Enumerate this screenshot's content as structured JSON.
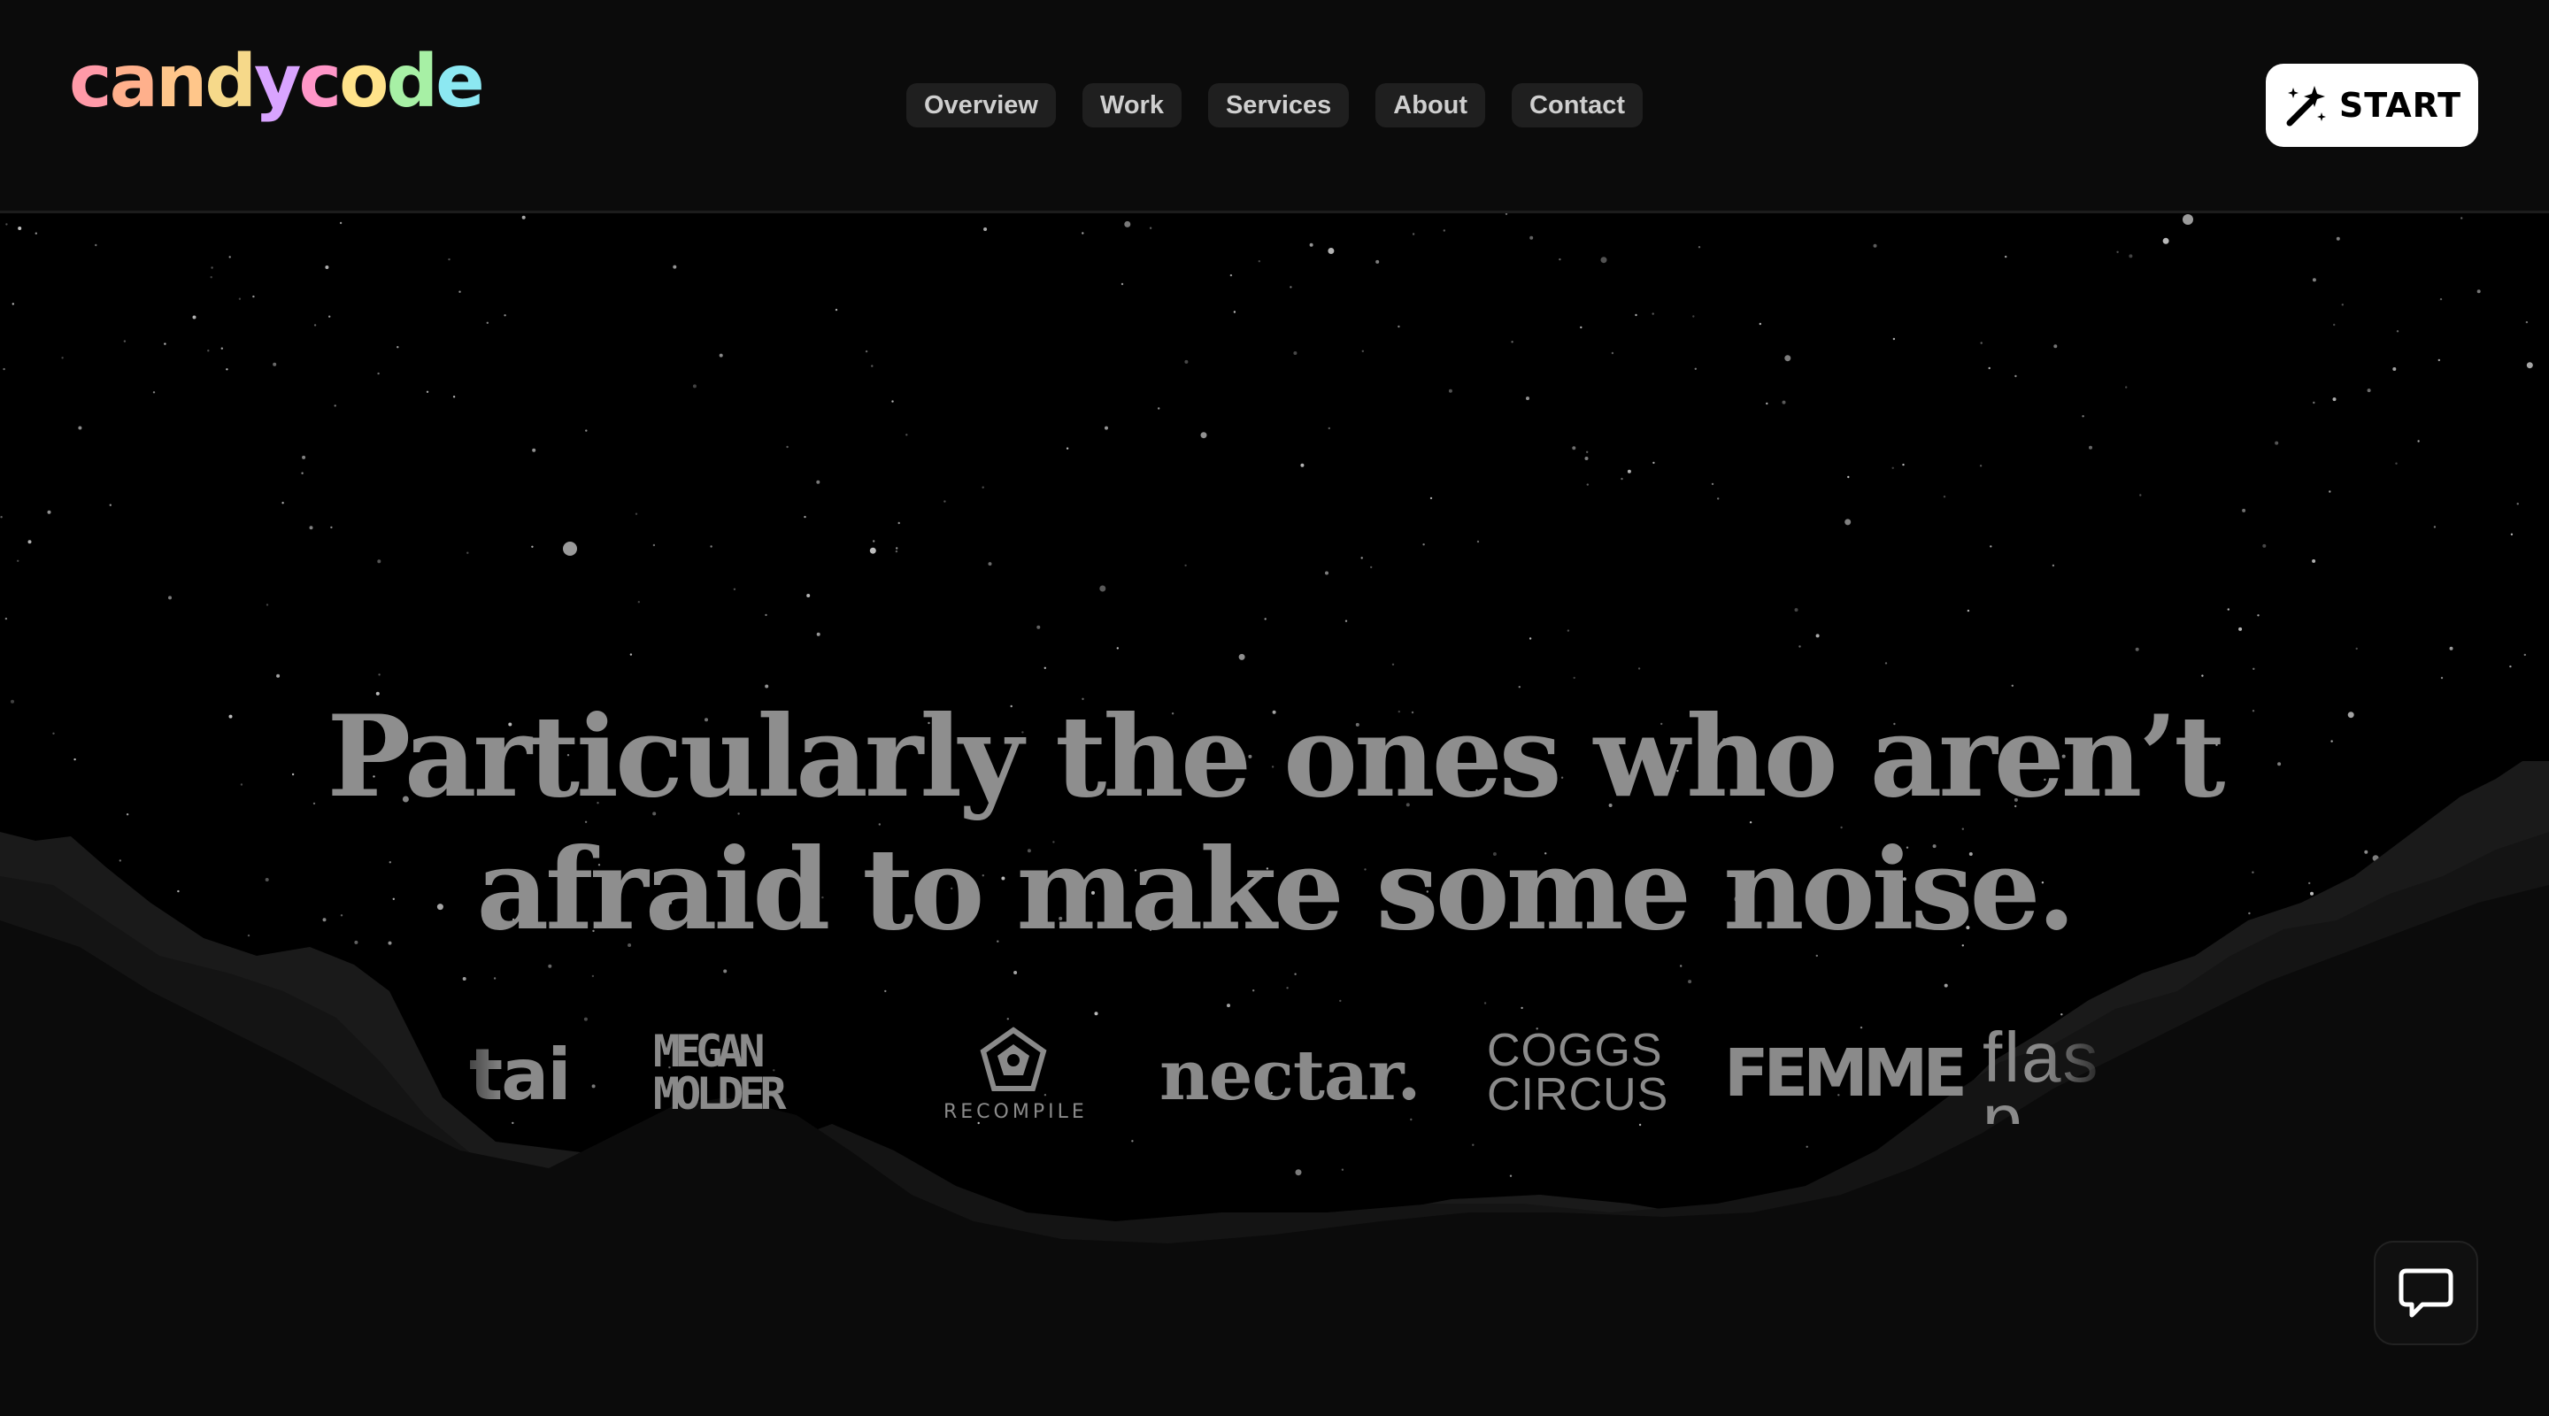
{
  "header": {
    "logo": {
      "letters": [
        {
          "char": "c",
          "color": "#ff9aa8"
        },
        {
          "char": "a",
          "color": "#ffb08c"
        },
        {
          "char": "n",
          "color": "#ffc68a"
        },
        {
          "char": "d",
          "color": "#f6d98a"
        },
        {
          "char": "y",
          "color": "#d9a4ff"
        },
        {
          "char": "c",
          "color": "#ff96c8"
        },
        {
          "char": "o",
          "color": "#ffe38a"
        },
        {
          "char": "d",
          "color": "#a7f0a5"
        },
        {
          "char": "e",
          "color": "#8ce8f2"
        }
      ]
    },
    "nav": [
      {
        "label": "Overview"
      },
      {
        "label": "Work"
      },
      {
        "label": "Services"
      },
      {
        "label": "About"
      },
      {
        "label": "Contact"
      }
    ],
    "start_label": "START"
  },
  "hero": {
    "headline_line1": "Particularly the ones who aren’t",
    "headline_line2": "afraid to make some noise."
  },
  "brands": {
    "tai": "tai",
    "megan_line1": "MEGAN",
    "megan_line2": "MOLDER",
    "recompile": "RECOMPILE",
    "nectar": "nectar.",
    "coggs_line1": "COGGS",
    "coggs_line2": "CIRCUS",
    "femme": "FEMME",
    "flash_line1": "flas",
    "flash_line2": "p"
  },
  "chat": {
    "icon": "chat-bubble-icon"
  },
  "colors": {
    "background": "#000000",
    "header_bg": "#0b0b0b",
    "nav_pill": "#1f1f1f",
    "headline": "#8e8e8e",
    "start_bg": "#ffffff"
  }
}
